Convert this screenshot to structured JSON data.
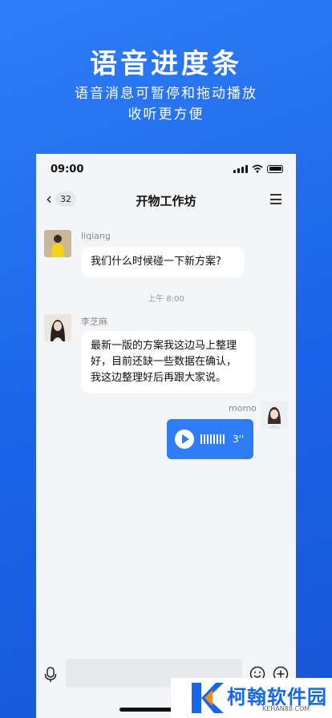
{
  "promo": {
    "title": "语音进度条",
    "subtitle_line1": "语音消息可暂停和拖动播放",
    "subtitle_line2": "收听更方便"
  },
  "status_bar": {
    "time": "09:00"
  },
  "header": {
    "back_count": "32",
    "title": "开物工作坊"
  },
  "messages": [
    {
      "sender": "liqiang",
      "text": "我们什么时候碰一下新方案?"
    },
    {
      "timestamp": "上午 8:00"
    },
    {
      "sender": "李芝麻",
      "lines": [
        "最新一版的方案我这边马上整理",
        "好，目前还缺一些数据在确认，",
        "我这边整理好后再跟大家说。"
      ]
    },
    {
      "sender": "momo",
      "type": "voice",
      "duration": "3''"
    }
  ],
  "watermark": {
    "name": "柯翰软件园",
    "url": "KEHAN88.COM"
  },
  "colors": {
    "accent": "#2f7df6",
    "background": "#1a63e8"
  }
}
